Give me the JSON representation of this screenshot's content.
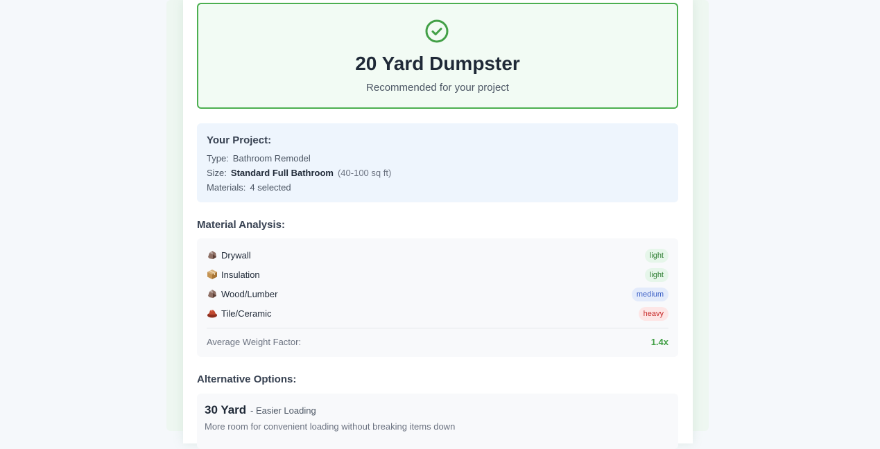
{
  "recommendation": {
    "title": "20 Yard Dumpster",
    "subtitle": "Recommended for your project",
    "icon": "check-circle-icon"
  },
  "project": {
    "heading": "Your Project:",
    "type_label": "Type:",
    "type_value": "Bathroom Remodel",
    "size_label": "Size:",
    "size_value": "Standard Full Bathroom",
    "size_note": "(40-100 sq ft)",
    "materials_label": "Materials:",
    "materials_value": "4 selected"
  },
  "analysis": {
    "heading": "Material Analysis:",
    "items": [
      {
        "name": "Drywall",
        "weight": "light",
        "icon": "rock-icon"
      },
      {
        "name": "Insulation",
        "weight": "light",
        "icon": "package-icon"
      },
      {
        "name": "Wood/Lumber",
        "weight": "medium",
        "icon": "rock-icon"
      },
      {
        "name": "Tile/Ceramic",
        "weight": "heavy",
        "icon": "brick-icon"
      }
    ],
    "avg_label": "Average Weight Factor:",
    "avg_value": "1.4x"
  },
  "alternatives": {
    "heading": "Alternative Options:",
    "options": [
      {
        "size": "30 Yard",
        "tag": "- Easier Loading",
        "description": "More room for convenient loading without breaking items down"
      }
    ]
  },
  "colors": {
    "success": "#4caf50",
    "light": "#2e7d32",
    "medium": "#3b5fc4",
    "heavy": "#c62828"
  }
}
